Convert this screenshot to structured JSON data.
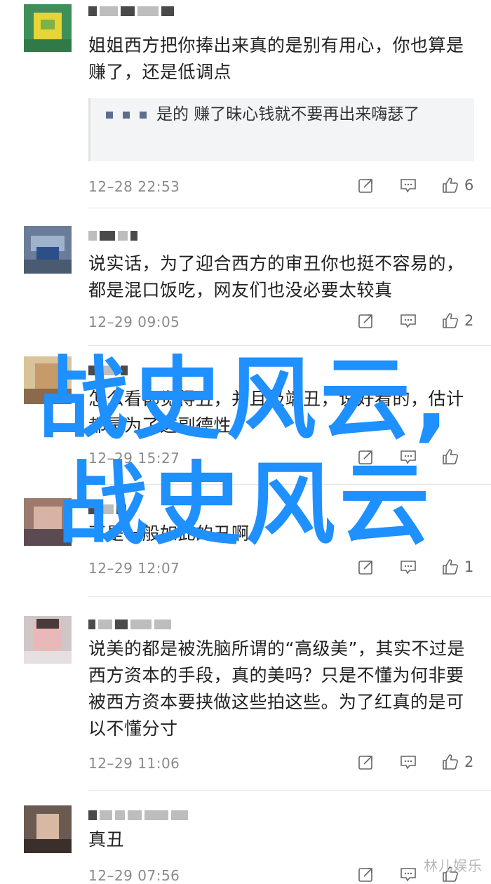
{
  "comments": [
    {
      "text": "姐姐西方把你捧出来真的是别有用心，你也算是赚了，还是低调点",
      "quote": "是的 赚了昧心钱就不要再出来嗨瑟了",
      "time": "12–28 22:53",
      "likes": "6"
    },
    {
      "text": "说实话，为了迎合西方的审丑你也挺不容易的，都是混口饭吃，网友们也没必要太较真",
      "time": "12–29 09:05",
      "likes": "2"
    },
    {
      "text": "怎么看都觉得丑，并且极端丑，说好看的，估计都是为了这副德性",
      "time": "12–29 15:27",
      "likes": ""
    },
    {
      "text": "不是一般如此的丑啊",
      "time": "12–29 12:07",
      "likes": "1"
    },
    {
      "text": "说美的都是被洗脑所谓的“高级美”，其实不过是西方资本的手段，真的美吗？只是不懂为何非要被西方资本要挟做这些拍这些。为了红真的是可以不懂分寸",
      "time": "12–29 11:06",
      "likes": "2"
    },
    {
      "text": "真丑",
      "time": "12–29 07:56",
      "likes": ""
    }
  ],
  "icons": {
    "share": "share-icon",
    "reply": "reply-icon",
    "like": "like-icon"
  },
  "colors": {
    "watermark": "#1e90ff",
    "time": "#8a8a8a",
    "text": "#222222"
  },
  "watermark": {
    "line1": "战史风云,",
    "line2": "战史风云"
  },
  "corner_mark": "林儿娱乐"
}
